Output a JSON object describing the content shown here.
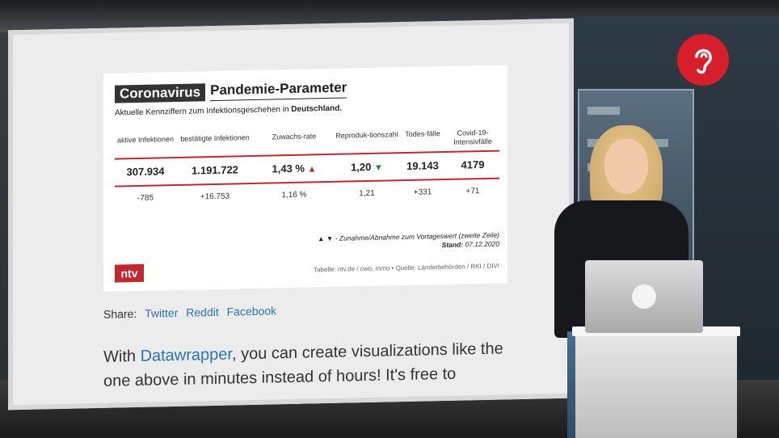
{
  "chart": {
    "tag": "Coronavirus",
    "title": "Pandemie-Parameter",
    "subtitle_prefix": "Aktuelle Kennziffern zum Infektionsgeschehen in",
    "subtitle_bold": "Deutschland.",
    "columns": [
      {
        "header": "aktive Infektionen",
        "main": "307.934",
        "change": "-785"
      },
      {
        "header": "bestätigte Infektionen",
        "main": "1.191.722",
        "change": "+16.753"
      },
      {
        "header": "Zuwachs-rate",
        "main": "1,43 %",
        "change": "1,16 %"
      },
      {
        "header": "Reproduk-tionszahl",
        "main": "1,20",
        "change": "1,21"
      },
      {
        "header": "Todes-fälle",
        "main": "19.143",
        "change": "+331"
      },
      {
        "header": "Covid-19-Intensivfälle",
        "main": "4179",
        "change": "+71"
      }
    ],
    "legend_text": "▲ ▼ - Zunahme/Abnahme zum Vortageswert (zweite Zeile)",
    "stand_label": "Stand:",
    "stand_date": "07.12.2020",
    "source": "Tabelle: ntv.de / cwo, mmo • Quelle: Länderbehörden / RKI / DIVI",
    "logo": "ntv",
    "colors": {
      "accent": "#c0282f",
      "up": "#c0282f",
      "down": "#1e8a2e"
    }
  },
  "share": {
    "label": "Share:",
    "links": [
      "Twitter",
      "Reddit",
      "Facebook"
    ]
  },
  "promo": {
    "prefix": "With",
    "link": "Datawrapper",
    "suffix": ", you can create visualizations like the one above in minutes instead of hours! It's free to"
  }
}
